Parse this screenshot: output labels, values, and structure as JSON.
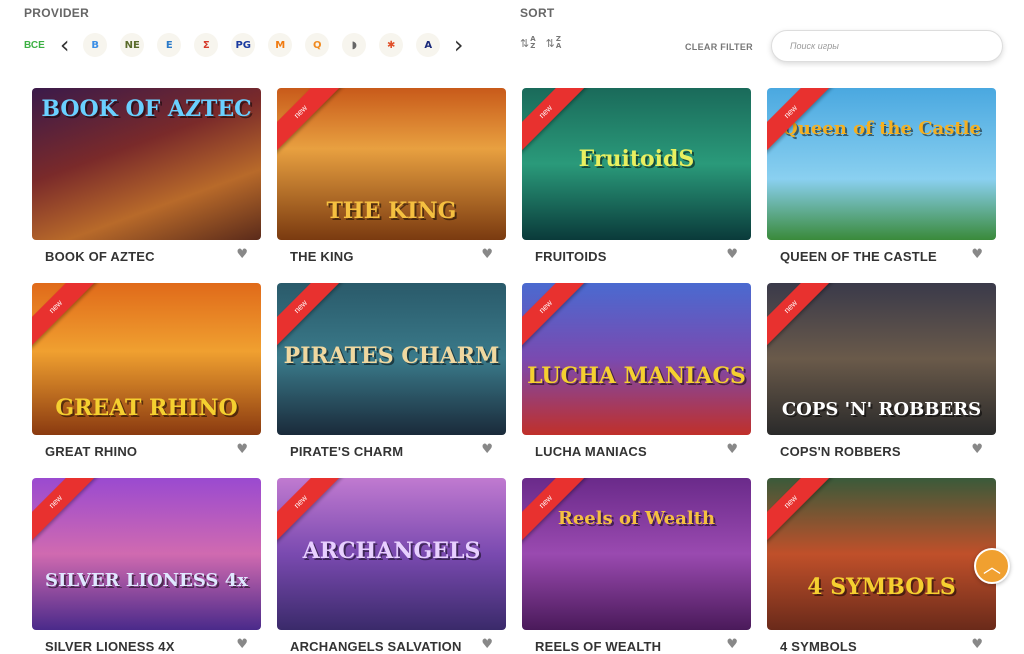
{
  "filters": {
    "provider_label": "PROVIDER",
    "all_label": "ВСЕ",
    "sort_label": "SORT",
    "clear_filter": "CLEAR FILTER",
    "search_placeholder": "Поиск игры",
    "prev_arrow": "‹",
    "next_arrow": "›",
    "sort_asc": [
      "A",
      "Z"
    ],
    "sort_desc": [
      "Z",
      "A"
    ],
    "providers": [
      {
        "glyph": "B",
        "color": "#3a8ee6",
        "icon": "provider-b-icon"
      },
      {
        "glyph": "NE",
        "color": "#5a6b2a",
        "icon": "netent-icon"
      },
      {
        "glyph": "E",
        "color": "#2a7ac9",
        "icon": "provider-e-icon"
      },
      {
        "glyph": "Σ",
        "color": "#d63a2a",
        "icon": "provider-sigma-icon"
      },
      {
        "glyph": "PG",
        "color": "#1a3aa0",
        "icon": "provider-pg-icon"
      },
      {
        "glyph": "M",
        "color": "#f07a10",
        "icon": "provider-m-icon"
      },
      {
        "glyph": "Q",
        "color": "#f08a20",
        "icon": "quickspin-icon"
      },
      {
        "glyph": "◗",
        "color": "#666666",
        "icon": "provider-half-icon"
      },
      {
        "glyph": "✱",
        "color": "#e0502a",
        "icon": "provider-tree-icon"
      },
      {
        "glyph": "A",
        "color": "#1a2a7a",
        "icon": "provider-a-icon"
      }
    ]
  },
  "games": [
    {
      "title": "BOOK OF AZTEC",
      "art": "BOOK OF AZTEC",
      "isNew": false,
      "bg": "linear-gradient(160deg,#3a1a4a 0%,#7a2a2a 40%,#b86a2a 70%,#5a2a1a 100%)",
      "artColor": "#6ad0ff",
      "artTop": 8
    },
    {
      "title": "THE KING",
      "art": "THE KING",
      "isNew": true,
      "bg": "linear-gradient(180deg,#c85a1a 0%,#e8a040 40%,#7a3a10 100%)",
      "artColor": "#f5c040",
      "artTop": 110
    },
    {
      "title": "FRUITOIDS",
      "art": "FruitoidS",
      "isNew": true,
      "bg": "linear-gradient(180deg,#1a6a5a 0%,#2a9a7a 50%,#0a3a3a 100%)",
      "artColor": "#e8f060",
      "artTop": 58
    },
    {
      "title": "QUEEN OF THE CASTLE",
      "art": "Queen of the Castle",
      "isNew": true,
      "bg": "linear-gradient(180deg,#4aa8e0 0%,#8ad0f0 60%,#3a8a3a 100%)",
      "artColor": "#f5b020",
      "artTop": 30
    },
    {
      "title": "GREAT RHINO",
      "art": "GREAT RHINO",
      "isNew": true,
      "bg": "linear-gradient(180deg,#e06a1a 0%,#f0a030 45%,#8a3a10 100%)",
      "artColor": "#f5d030",
      "artTop": 112
    },
    {
      "title": "PIRATE'S CHARM",
      "art": "PIRATES CHARM",
      "isNew": true,
      "bg": "linear-gradient(180deg,#2a5a6a 0%,#3a7a8a 50%,#1a2a3a 100%)",
      "artColor": "#f0d8a0",
      "artTop": 60
    },
    {
      "title": "LUCHA MANIACS",
      "art": "LUCHA MANIACS",
      "isNew": true,
      "bg": "linear-gradient(180deg,#4a6ad0 0%,#7a4ab0 50%,#c0302a 100%)",
      "artColor": "#f5d030",
      "artTop": 80
    },
    {
      "title": "COPS'N ROBBERS",
      "art": "COPS 'N' ROBBERS",
      "isNew": true,
      "bg": "linear-gradient(180deg,#3a3a4a 0%,#6a5a4a 50%,#2a2a2a 100%)",
      "artColor": "#ffffff",
      "artTop": 116
    },
    {
      "title": "SILVER LIONESS 4X",
      "art": "SILVER LIONESS 4x",
      "isNew": true,
      "bg": "linear-gradient(180deg,#9a4ad0 0%,#d06ab0 50%,#4a2a8a 100%)",
      "artColor": "#e0e8ff",
      "artTop": 92
    },
    {
      "title": "ARCHANGELS SALVATION",
      "art": "ARCHANGELS",
      "isNew": true,
      "bg": "linear-gradient(180deg,#c07ad0 0%,#7a4ab0 50%,#3a2a6a 100%)",
      "artColor": "#e8d0ff",
      "artTop": 60
    },
    {
      "title": "REELS OF WEALTH",
      "art": "Reels of Wealth",
      "isNew": true,
      "bg": "linear-gradient(180deg,#6a2a8a 0%,#9a4ab0 50%,#4a1a5a 100%)",
      "artColor": "#f5c040",
      "artTop": 30
    },
    {
      "title": "4 SYMBOLS",
      "art": "4 SYMBOLS",
      "isNew": true,
      "bg": "linear-gradient(180deg,#3a5a3a 0%,#c0502a 50%,#6a2a1a 100%)",
      "artColor": "#f5d030",
      "artTop": 96
    }
  ],
  "new_label": "new",
  "heart_glyph": "♥",
  "scroll_top_glyph": "︿"
}
